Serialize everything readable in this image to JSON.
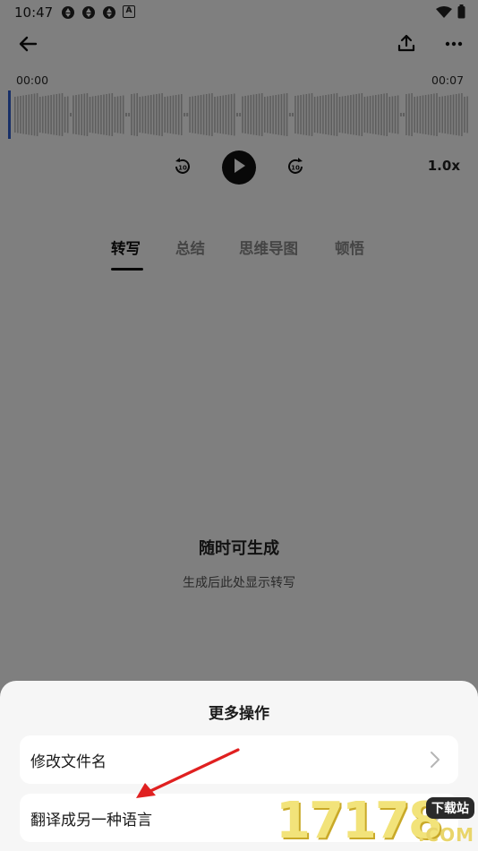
{
  "status_bar": {
    "time": "10:47",
    "badge_letter": "A"
  },
  "player": {
    "time_start": "00:00",
    "time_end": "00:07",
    "speed": "1.0x",
    "rewind_seconds": "10",
    "forward_seconds": "10",
    "progress": 0.0
  },
  "tabs": [
    {
      "label": "转写",
      "active": true
    },
    {
      "label": "总结",
      "active": false
    },
    {
      "label": "思维导图",
      "active": false
    },
    {
      "label": "顿悟",
      "active": false
    }
  ],
  "empty_state": {
    "title": "随时可生成",
    "subtitle": "生成后此处显示转写"
  },
  "sheet": {
    "title": "更多操作",
    "options": [
      {
        "label": "修改文件名"
      },
      {
        "label": "翻译成另一种语言"
      }
    ]
  },
  "watermark": {
    "digits": "17178",
    "tag": "下载站",
    "suffix": ".COM"
  },
  "colors": {
    "accent": "#111111",
    "scrim": "rgba(0,0,0,0.5)",
    "annotation_arrow": "#e02020",
    "wave_bar": "#bdbdbd",
    "playhead": "#2f5fd0"
  },
  "icons": [
    "back-arrow-icon",
    "share-upload-icon",
    "more-dots-icon",
    "rewind-10-icon",
    "play-icon",
    "forward-10-icon",
    "chevron-right-icon",
    "wifi-icon",
    "battery-icon"
  ]
}
